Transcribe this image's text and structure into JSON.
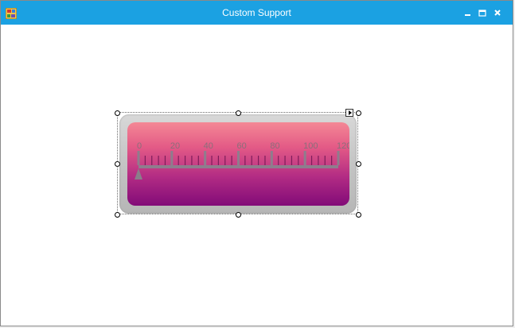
{
  "window": {
    "title": "Custom Support",
    "controls": [
      "minimize-icon",
      "maximize-icon",
      "close-icon"
    ]
  },
  "linear_gauge": {
    "scale_min": 0,
    "scale_max": 120,
    "major_interval": 20,
    "minor_per_major": 4,
    "tick_labels": [
      "0",
      "20",
      "40",
      "60",
      "80",
      "100",
      "120"
    ],
    "pointer_value": 0,
    "colors": {
      "face_top": "#f48895",
      "face_bottom": "#820b78",
      "scale_bar": "#8e7d8d",
      "ticks": "#7d1d5a",
      "labels": "#8a6f7a",
      "pointer": "#8a7f8a"
    }
  },
  "colors": {
    "titlebar": "#1ba1e2",
    "client_background": "#ffffff"
  }
}
